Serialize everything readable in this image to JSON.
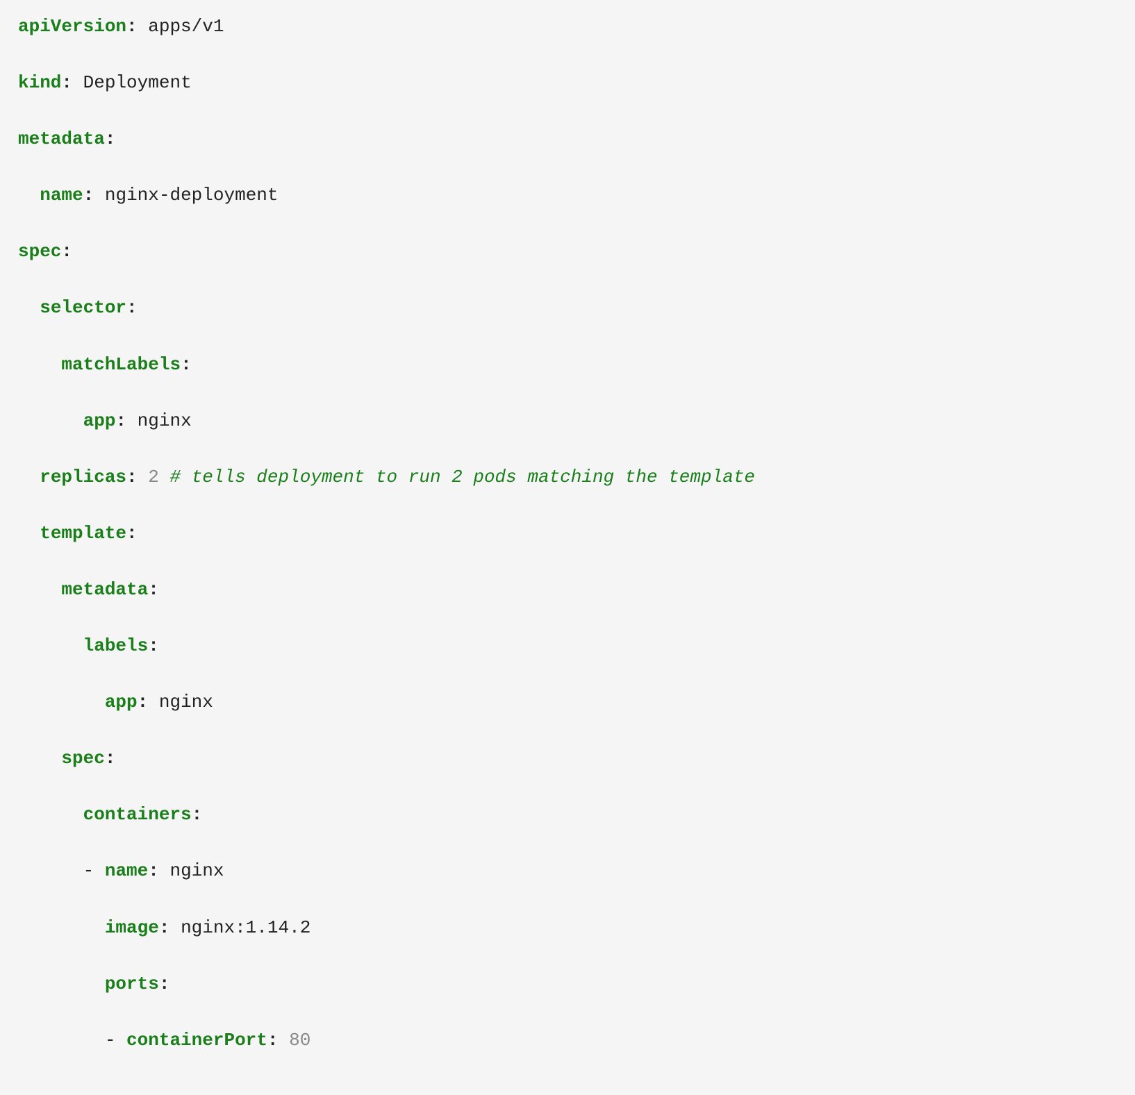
{
  "yaml": {
    "apiVersion_key": "apiVersion",
    "apiVersion_val": "apps/v1",
    "kind_key": "kind",
    "kind_val": "Deployment",
    "metadata_key": "metadata",
    "metadata_name_key": "name",
    "metadata_name_val": "nginx-deployment",
    "spec_key": "spec",
    "selector_key": "selector",
    "matchLabels_key": "matchLabels",
    "matchLabels_app_key": "app",
    "matchLabels_app_val": "nginx",
    "replicas_key": "replicas",
    "replicas_val": "2",
    "replicas_comment": "# tells deployment to run 2 pods matching the template",
    "template_key": "template",
    "tpl_metadata_key": "metadata",
    "tpl_labels_key": "labels",
    "tpl_labels_app_key": "app",
    "tpl_labels_app_val": "nginx",
    "tpl_spec_key": "spec",
    "containers_key": "containers",
    "container_name_key": "name",
    "container_name_val": "nginx",
    "container_image_key": "image",
    "container_image_val": "nginx:1.14.2",
    "container_ports_key": "ports",
    "containerPort_key": "containerPort",
    "containerPort_val": "80"
  }
}
